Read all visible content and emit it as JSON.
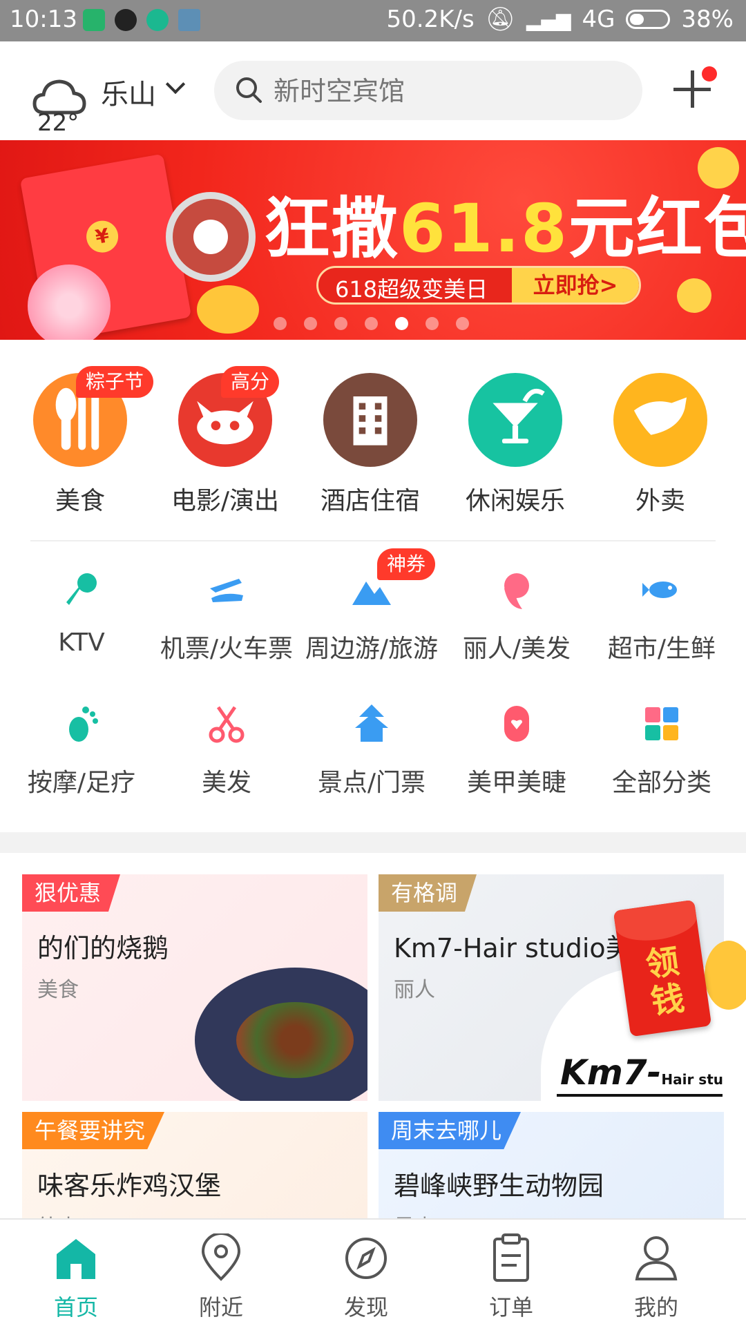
{
  "status_bar": {
    "time": "10:13",
    "net_speed": "50.2K/s",
    "network": "4G",
    "battery": "38%"
  },
  "header": {
    "temperature": "22°",
    "city": "乐山",
    "search_placeholder": "新时空宾馆"
  },
  "banner": {
    "title_prefix": "狂撒",
    "title_amount": "61.8",
    "title_suffix": "元红包",
    "event": "618超级变美日",
    "cta": "立即抢>",
    "slide_count": 7,
    "active_slide": 5
  },
  "primary_categories": [
    {
      "label": "美食",
      "tag": "粽子节",
      "color": "#ff8a2a",
      "icon": "fork-spoon-icon"
    },
    {
      "label": "电影/演出",
      "tag": "高分",
      "color": "#e8392e",
      "icon": "cat-face-icon"
    },
    {
      "label": "酒店住宿",
      "tag": "",
      "color": "#7a4a3c",
      "icon": "building-icon"
    },
    {
      "label": "休闲娱乐",
      "tag": "",
      "color": "#17c3a1",
      "icon": "cocktail-icon"
    },
    {
      "label": "外卖",
      "tag": "",
      "color": "#ffb51e",
      "icon": "kangaroo-icon"
    }
  ],
  "secondary_categories": [
    {
      "label": "KTV",
      "tag": "",
      "icon": "microphone-icon"
    },
    {
      "label": "机票/火车票",
      "tag": "",
      "icon": "plane-train-icon"
    },
    {
      "label": "周边游/旅游",
      "tag": "神券",
      "icon": "mountain-icon"
    },
    {
      "label": "丽人/美发",
      "tag": "",
      "icon": "woman-head-icon"
    },
    {
      "label": "超市/生鲜",
      "tag": "",
      "icon": "fish-icon"
    },
    {
      "label": "按摩/足疗",
      "tag": "",
      "icon": "foot-icon"
    },
    {
      "label": "美发",
      "tag": "",
      "icon": "scissors-icon"
    },
    {
      "label": "景点/门票",
      "tag": "",
      "icon": "pagoda-icon"
    },
    {
      "label": "美甲美睫",
      "tag": "",
      "icon": "nail-icon"
    },
    {
      "label": "全部分类",
      "tag": "",
      "icon": "grid-icon"
    }
  ],
  "cards": [
    {
      "badge": "狠优惠",
      "title": "的们的烧鹅",
      "subtitle": "美食",
      "badge_color": "#ff4b55"
    },
    {
      "badge": "有格调",
      "title": "Km7-Hair studio美",
      "subtitle": "丽人",
      "badge_color": "#c8a46a"
    },
    {
      "badge": "午餐要讲究",
      "title": "味客乐炸鸡汉堡",
      "subtitle": "外卖",
      "badge_color": "#ff8a1e"
    },
    {
      "badge": "周末去哪儿",
      "title": "碧峰峡野生动物园",
      "subtitle": "景点",
      "badge_color": "#3f8cf2"
    }
  ],
  "km7_logo": {
    "main": "Km7-",
    "sub": "Hair studio"
  },
  "red_packet": {
    "text": "领钱"
  },
  "bottom_nav": [
    {
      "label": "首页",
      "icon": "home-icon",
      "active": true
    },
    {
      "label": "附近",
      "icon": "location-pin-icon",
      "active": false
    },
    {
      "label": "发现",
      "icon": "compass-icon",
      "active": false
    },
    {
      "label": "订单",
      "icon": "clipboard-icon",
      "active": false
    },
    {
      "label": "我的",
      "icon": "user-icon",
      "active": false
    }
  ],
  "colors": {
    "accent": "#14b7a6",
    "banner_red": "#f2261c",
    "tag_red": "#ff3a2b"
  }
}
